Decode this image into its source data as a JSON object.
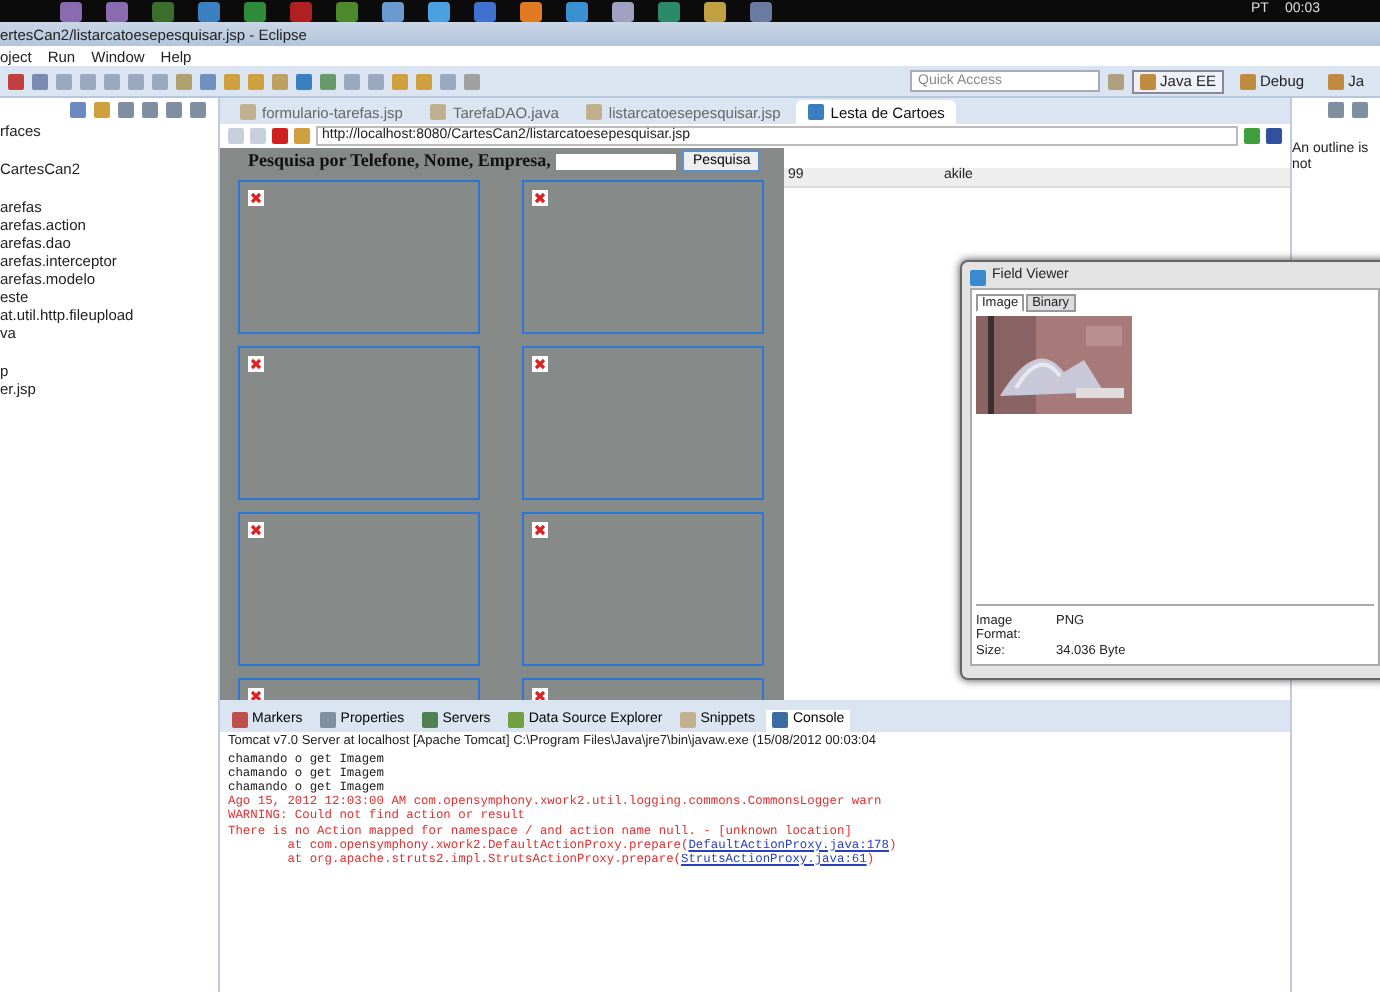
{
  "taskbar": {
    "language": "PT",
    "clock": "00:03"
  },
  "window": {
    "title": "ertesCan2/listarcatoesepesquisar.jsp - Eclipse"
  },
  "menu": [
    "oject",
    "Run",
    "Window",
    "Help"
  ],
  "quick_access": {
    "placeholder": "Quick Access"
  },
  "perspectives": [
    {
      "label": "Java EE",
      "selected": true
    },
    {
      "label": "Debug",
      "selected": false
    },
    {
      "label": "Ja",
      "selected": false
    }
  ],
  "explorer": {
    "groups": [
      {
        "items": [
          "rfaces"
        ]
      },
      {
        "items": [
          "CartesCan2"
        ]
      },
      {
        "items": [
          "arefas",
          "arefas.action",
          "arefas.dao",
          "arefas.interceptor",
          "arefas.modelo",
          "este",
          "at.util.http.fileupload",
          "va"
        ]
      },
      {
        "items": [
          "p",
          "er.jsp"
        ]
      }
    ]
  },
  "editor_tabs": [
    {
      "label": "formulario-tarefas.jsp",
      "selected": false
    },
    {
      "label": "TarefaDAO.java",
      "selected": false
    },
    {
      "label": "listarcatoesepesquisar.jsp",
      "selected": false
    },
    {
      "label": "Lesta de Cartoes",
      "selected": true
    }
  ],
  "browser": {
    "url": "http://localhost:8080/CartesCan2/listarcatoesepesquisar.jsp",
    "search_label": "Pesquisa por Telefone, Nome, Empresa,",
    "search_button": "Pesquisa",
    "cards": [
      {
        "kind": "broken-image"
      },
      {
        "kind": "broken-image"
      },
      {
        "kind": "broken-image"
      },
      {
        "kind": "broken-image"
      },
      {
        "kind": "broken-image"
      },
      {
        "kind": "broken-image"
      },
      {
        "kind": "broken-image"
      },
      {
        "kind": "broken-image"
      }
    ]
  },
  "table": {
    "rows": [
      {
        "cells": [
          "99",
          "akile"
        ]
      }
    ]
  },
  "outline": {
    "message": "An outline is not"
  },
  "bottom_tabs": [
    {
      "label": "Markers",
      "selected": false
    },
    {
      "label": "Properties",
      "selected": false
    },
    {
      "label": "Servers",
      "selected": false
    },
    {
      "label": "Data Source Explorer",
      "selected": false
    },
    {
      "label": "Snippets",
      "selected": false
    },
    {
      "label": "Console",
      "selected": true
    }
  ],
  "console": {
    "header": "Tomcat v7.0 Server at localhost [Apache Tomcat] C:\\Program Files\\Java\\jre7\\bin\\javaw.exe (15/08/2012 00:03:04",
    "lines": [
      {
        "kind": "out",
        "text": "chamando o get Imagem"
      },
      {
        "kind": "out",
        "text": "chamando o get Imagem"
      },
      {
        "kind": "out",
        "text": "chamando o get Imagem"
      },
      {
        "kind": "err",
        "text": "Ago 15, 2012 12:03:00 AM com.opensymphony.xwork2.util.logging.commons.CommonsLogger warn"
      },
      {
        "kind": "err",
        "text": "WARNING: Could not find action or result"
      },
      {
        "kind": "err",
        "text": "There is no Action mapped for namespace / and action name null. - [unknown location]"
      },
      {
        "kind": "trace",
        "text": "at com.opensymphony.xwork2.DefaultActionProxy.prepare(",
        "link": "DefaultActionProxy.java:178",
        "after": ")"
      },
      {
        "kind": "trace",
        "text": "at org.apache.struts2.impl.StrutsActionProxy.prepare(",
        "link": "StrutsActionProxy.java:61",
        "after": ")"
      }
    ]
  },
  "field_viewer": {
    "title": "Field Viewer",
    "tabs": [
      {
        "label": "Image",
        "selected": true
      },
      {
        "label": "Binary",
        "selected": false
      }
    ],
    "properties": [
      {
        "label": "Image Format:",
        "value": "PNG"
      },
      {
        "label": "Size:",
        "value": "34.036 Byte"
      }
    ]
  }
}
